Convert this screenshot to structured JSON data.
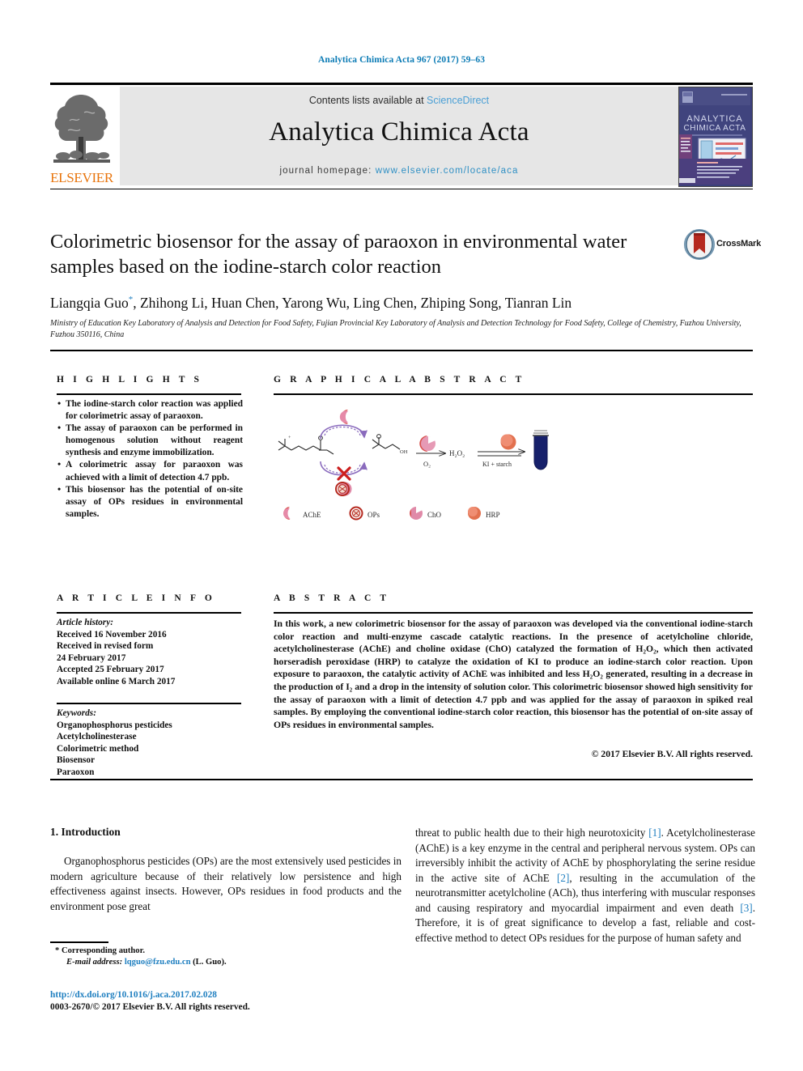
{
  "running_head": "Analytica Chimica Acta 967 (2017) 59–63",
  "masthead": {
    "contents_prefix": "Contents lists available at ",
    "sciencedirect": "ScienceDirect",
    "journal_name": "Analytica Chimica Acta",
    "homepage_prefix": "journal homepage: ",
    "homepage_url": "www.elsevier.com/locate/aca",
    "publisher": "ELSEVIER",
    "cover_title_line1": "ANALYTICA",
    "cover_title_line2": "CHIMICA ACTA"
  },
  "article": {
    "title": "Colorimetric biosensor for the assay of paraoxon in environmental water samples based on the iodine-starch color reaction",
    "crossmark_label": "CrossMark",
    "authors": "Liangqia Guo, Zhihong Li, Huan Chen, Yarong Wu, Ling Chen, Zhiping Song, Tianran Lin",
    "author_first": "Liangqia Guo",
    "author_rest": ", Zhihong Li, Huan Chen, Yarong Wu, Ling Chen, Zhiping Song, Tianran Lin",
    "corresponding_marker": "*",
    "affiliation": "Ministry of Education Key Laboratory of Analysis and Detection for Food Safety, Fujian Provincial Key Laboratory of Analysis and Detection Technology for Food Safety, College of Chemistry, Fuzhou University, Fuzhou 350116, China"
  },
  "highlights": {
    "heading": "H I G H L I G H T S",
    "items": [
      "The iodine-starch color reaction was applied for colorimetric assay of paraoxon.",
      "The assay of paraoxon can be performed in homogenous solution without reagent synthesis and enzyme immobilization.",
      "A colorimetric assay for paraoxon was achieved with a limit of detection 4.7 ppb.",
      "This biosensor has the potential of on-site assay of OPs residues in environmental samples."
    ]
  },
  "graphical_abstract": {
    "heading": "G R A P H I C A L  A B S T R A C T",
    "labels": {
      "oh": "OH",
      "o2": "O₂",
      "h2o2": "H₂O₂",
      "ki_starch": "KI + starch"
    },
    "legend": [
      {
        "name": "AChE",
        "color": "#d9534f"
      },
      {
        "name": "OPs",
        "color": "#c0392b"
      },
      {
        "name": "ChO",
        "color": "#e08aa8"
      },
      {
        "name": "HRP",
        "color": "#e2714f"
      }
    ]
  },
  "article_info": {
    "heading": "A R T I C L E  I N F O",
    "history_label": "Article history:",
    "history": [
      "Received 16 November 2016",
      "Received in revised form",
      "24 February 2017",
      "Accepted 25 February 2017",
      "Available online 6 March 2017"
    ],
    "keywords_label": "Keywords:",
    "keywords": [
      "Organophosphorus pesticides",
      "Acetylcholinesterase",
      "Colorimetric method",
      "Biosensor",
      "Paraoxon"
    ]
  },
  "abstract": {
    "heading": "A B S T R A C T",
    "text": "In this work, a new colorimetric biosensor for the assay of paraoxon was developed via the conventional iodine-starch color reaction and multi-enzyme cascade catalytic reactions. In the presence of acetylcholine chloride, acetylcholinesterase (AChE) and choline oxidase (ChO) catalyzed the formation of H₂O₂, which then activated horseradish peroxidase (HRP) to catalyze the oxidation of KI to produce an iodine-starch color reaction. Upon exposure to paraoxon, the catalytic activity of AChE was inhibited and less H₂O₂ generated, resulting in a decrease in the production of I₂ and a drop in the intensity of solution color. This colorimetric biosensor showed high sensitivity for the assay of paraoxon with a limit of detection 4.7 ppb and was applied for the assay of paraoxon in spiked real samples. By employing the conventional iodine-starch color reaction, this biosensor has the potential of on-site assay of OPs residues in environmental samples.",
    "copyright": "© 2017 Elsevier B.V. All rights reserved."
  },
  "body": {
    "section_heading": "1. Introduction",
    "left_paragraph": "Organophosphorus pesticides (OPs) are the most extensively used pesticides in modern agriculture because of their relatively low persistence and high effectiveness against insects. However, OPs residues in food products and the environment pose great",
    "right_part1": "threat to public health due to their high neurotoxicity ",
    "right_ref1": "[1]",
    "right_part2": ". Acetylcholinesterase (AChE) is a key enzyme in the central and peripheral nervous system. OPs can irreversibly inhibit the activity of AChE by phosphorylating the serine residue in the active site of AChE ",
    "right_ref2": "[2]",
    "right_part3": ", resulting in the accumulation of the neurotransmitter acetylcholine (ACh), thus interfering with muscular responses and causing respiratory and myocardial impairment and even death ",
    "right_ref3": "[3]",
    "right_part4": ". Therefore, it is of great significance to develop a fast, reliable and cost-effective method to detect OPs residues for the purpose of human safety and"
  },
  "footer": {
    "corresponding_marker": "*",
    "corresponding_label": "Corresponding author.",
    "email_label": "E-mail address:",
    "email": "lqguo@fzu.edu.cn",
    "email_suffix": "(L. Guo).",
    "doi": "http://dx.doi.org/10.1016/j.aca.2017.02.028",
    "issn_line": "0003-2670/© 2017 Elsevier B.V. All rights reserved."
  },
  "colors": {
    "link_blue": "#1f7fc0",
    "sciencedirect_blue": "#4a9fd5",
    "elsevier_orange": "#e8740c",
    "running_head_blue": "#0b7bb5"
  }
}
